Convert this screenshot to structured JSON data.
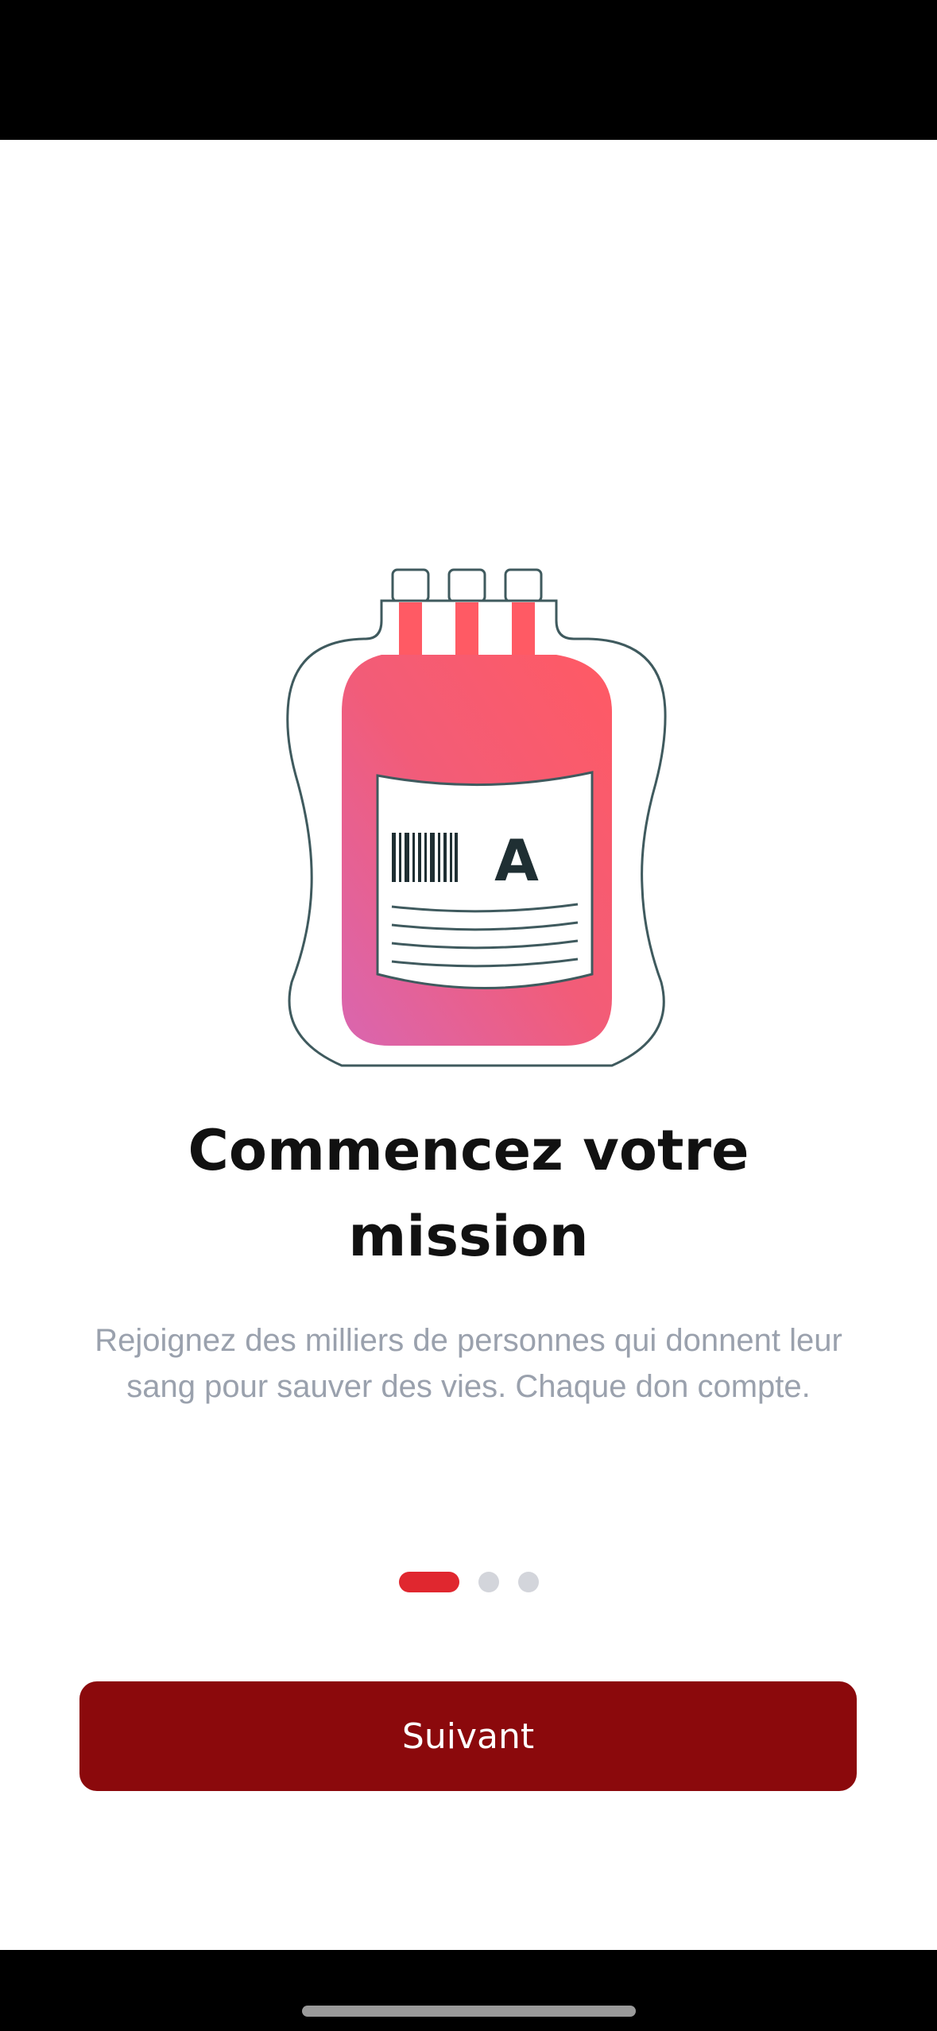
{
  "onboarding": {
    "illustration_icon": "blood-bag-icon",
    "blood_type_label": "A",
    "title": "Commencez votre mission",
    "subtitle": "Rejoignez des milliers de personnes qui donnent leur sang pour sauver des vies. Chaque don compte.",
    "pagination": {
      "total": 3,
      "current": 1
    },
    "next_button_label": "Suivant"
  },
  "colors": {
    "accent": "#e0272f",
    "button": "#8b090c",
    "bag_gradient_start": "#ff5a64",
    "bag_gradient_end": "#d966b0",
    "outline": "#3f5a5e"
  }
}
